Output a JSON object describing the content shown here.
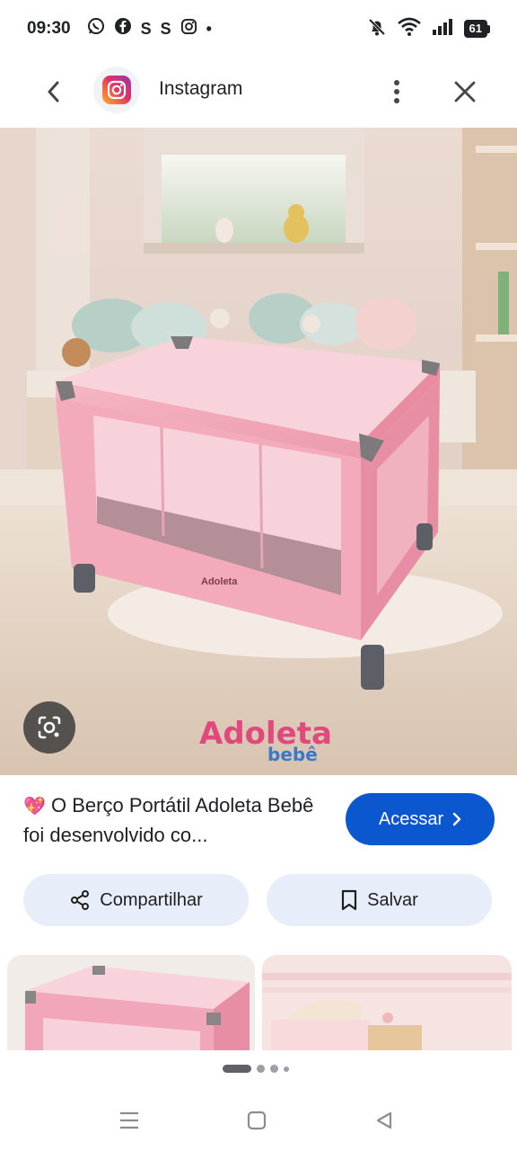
{
  "status_bar": {
    "time": "09:30",
    "notification_icons": [
      "whatsapp-icon",
      "facebook-icon",
      "s-app-icon",
      "s-app-icon",
      "instagram-icon",
      "dot-icon"
    ],
    "s_letter": "S",
    "bullet": "•",
    "right_icons": [
      "mute-bell-icon",
      "wifi-icon",
      "signal-icon",
      "battery-icon"
    ],
    "battery_level": "61"
  },
  "top_bar": {
    "back_icon": "chevron-left-icon",
    "app_name": "Instagram",
    "more_icon": "more-vertical-icon",
    "close_icon": "close-icon"
  },
  "image": {
    "brand_line1": "Adoleta",
    "brand_line2": "bebê",
    "crib_logo": "Adoleta",
    "lens_icon": "lens-search-icon"
  },
  "caption": {
    "emoji": "💖",
    "text": "O Berço Portátil Adoleta Bebê foi desenvolvido co..."
  },
  "access_button": {
    "label": "Acessar",
    "chevron": "›"
  },
  "actions": {
    "share_label": "Compartilhar",
    "save_label": "Salvar"
  },
  "colors": {
    "accent": "#0b57d0",
    "action_bg": "#e8eef9",
    "crib_pink": "#f2a8b8"
  },
  "pager": {
    "pages": 4,
    "active_index": 0
  },
  "nav_bar": {
    "icons": [
      "menu-icon",
      "home-square-icon",
      "back-triangle-icon"
    ]
  }
}
